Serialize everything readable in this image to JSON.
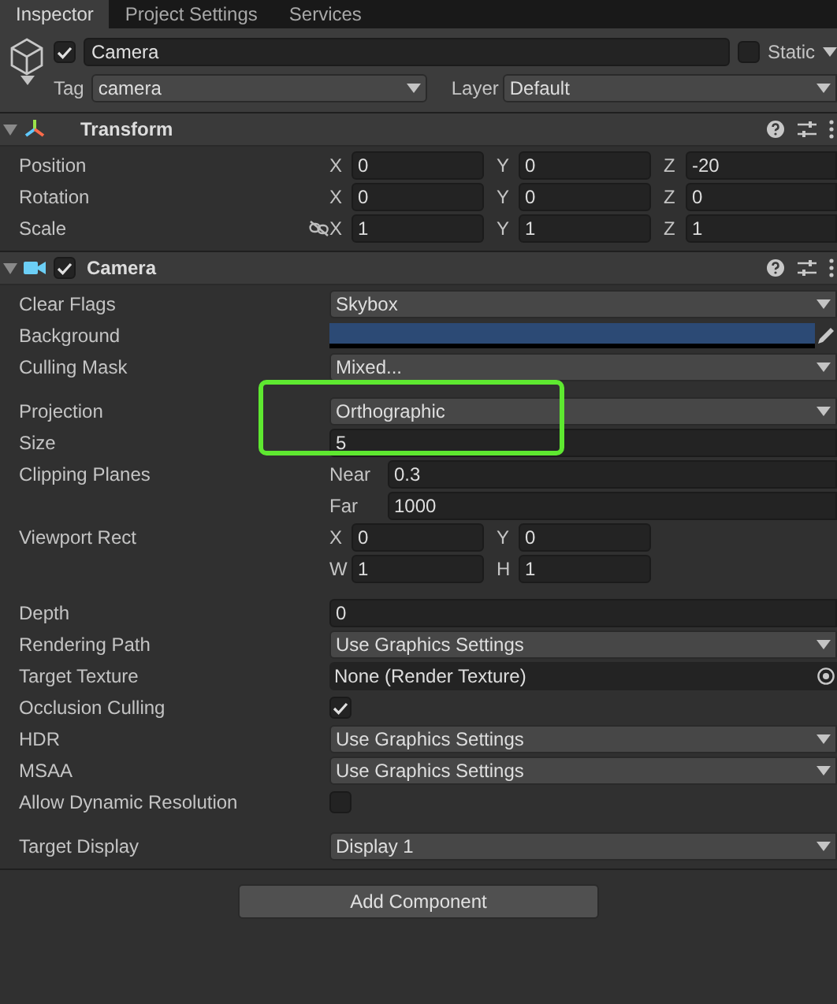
{
  "tabs": [
    {
      "label": "Inspector",
      "selected": true
    },
    {
      "label": "Project Settings",
      "selected": false
    },
    {
      "label": "Services",
      "selected": false
    }
  ],
  "object": {
    "active": true,
    "name": "Camera",
    "static": false,
    "static_label": "Static",
    "tag_label": "Tag",
    "tag": "camera",
    "layer_label": "Layer",
    "layer": "Default"
  },
  "components": [
    {
      "title": "Transform",
      "kind": "transform",
      "expanded": true,
      "rows": [
        {
          "kind": "vector",
          "label": "Position",
          "fields": [
            {
              "axis": "X",
              "value": "0"
            },
            {
              "axis": "Y",
              "value": "0"
            },
            {
              "axis": "Z",
              "value": "-20"
            }
          ]
        },
        {
          "kind": "vector",
          "label": "Rotation",
          "fields": [
            {
              "axis": "X",
              "value": "0"
            },
            {
              "axis": "Y",
              "value": "0"
            },
            {
              "axis": "Z",
              "value": "0"
            }
          ]
        },
        {
          "kind": "vector",
          "label": "Scale",
          "proportional": false,
          "fields": [
            {
              "axis": "X",
              "value": "1"
            },
            {
              "axis": "Y",
              "value": "1"
            },
            {
              "axis": "Z",
              "value": "1"
            }
          ]
        }
      ]
    },
    {
      "title": "Camera",
      "kind": "camera",
      "expanded": true,
      "enabled": true,
      "rows": [
        {
          "kind": "dropdown",
          "label": "Clear Flags",
          "value": "Skybox"
        },
        {
          "kind": "color",
          "label": "Background",
          "color": "#2c4a75"
        },
        {
          "kind": "dropdown",
          "label": "Culling Mask",
          "value": "Mixed..."
        },
        {
          "kind": "dropdown",
          "label": "Projection",
          "value": "Orthographic",
          "spaced": true,
          "highlighted": true
        },
        {
          "kind": "field",
          "label": "Size",
          "value": "5"
        },
        {
          "kind": "stack",
          "label": "Clipping Planes",
          "fields": [
            {
              "axis": "Near",
              "value": "0.3"
            },
            {
              "axis": "Far",
              "value": "1000"
            }
          ]
        },
        {
          "kind": "grid",
          "label": "Viewport Rect",
          "fields": [
            {
              "axis": "X",
              "value": "0"
            },
            {
              "axis": "Y",
              "value": "0"
            },
            {
              "axis": "W",
              "value": "1"
            },
            {
              "axis": "H",
              "value": "1"
            }
          ]
        },
        {
          "kind": "field",
          "label": "Depth",
          "value": "0",
          "spaced": true
        },
        {
          "kind": "dropdown",
          "label": "Rendering Path",
          "value": "Use Graphics Settings"
        },
        {
          "kind": "object",
          "label": "Target Texture",
          "value": "None (Render Texture)"
        },
        {
          "kind": "checkbox",
          "label": "Occlusion Culling",
          "checked": true
        },
        {
          "kind": "dropdown",
          "label": "HDR",
          "value": "Use Graphics Settings"
        },
        {
          "kind": "dropdown",
          "label": "MSAA",
          "value": "Use Graphics Settings"
        },
        {
          "kind": "checkbox",
          "label": "Allow Dynamic Resolution",
          "checked": false
        },
        {
          "kind": "dropdown",
          "label": "Target Display",
          "value": "Display 1",
          "spaced": true
        }
      ]
    }
  ],
  "add_button": "Add Component"
}
